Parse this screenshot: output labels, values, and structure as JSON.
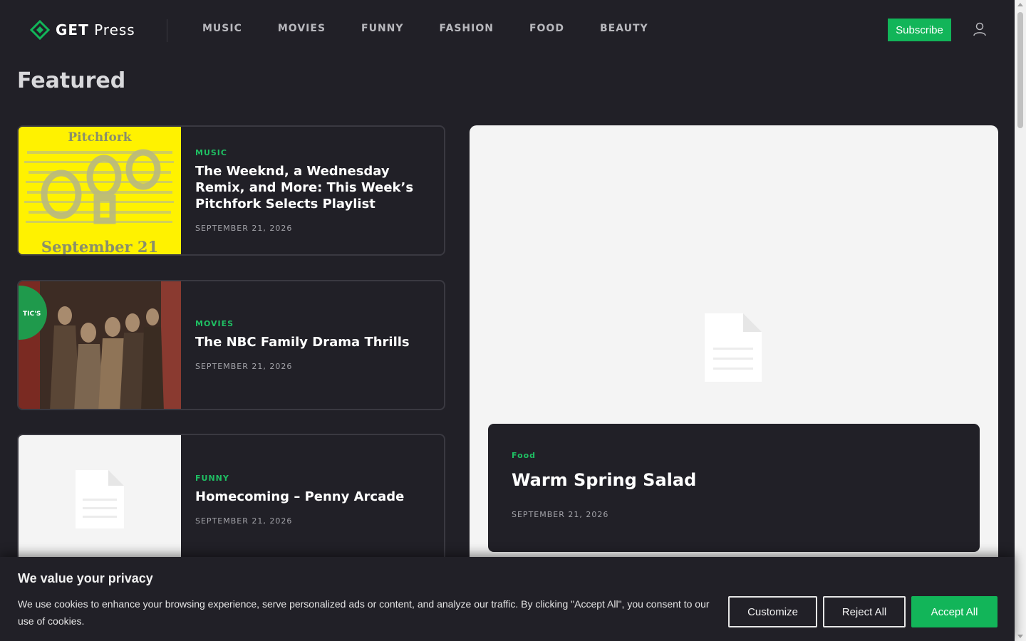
{
  "header": {
    "logo_bold": "GET",
    "logo_light": "Press",
    "nav": [
      "MUSIC",
      "MOVIES",
      "FUNNY",
      "FASHION",
      "FOOD",
      "BEAUTY"
    ],
    "subscribe_label": "Subscribe",
    "accent_color": "#12b559"
  },
  "page_title": "Featured",
  "cards": [
    {
      "category": "MUSIC",
      "title": "The Weeknd, a Wednesday Remix, and More: This Week’s Pitchfork Selects Playlist",
      "date": "SEPTEMBER 21, 2026",
      "thumb_top_text": "Pitchfork",
      "thumb_bottom_text": "September 21"
    },
    {
      "category": "MOVIES",
      "title": "The NBC Family Drama Thrills",
      "date": "SEPTEMBER 21, 2026",
      "badge_text": "TIC'S"
    },
    {
      "category": "FUNNY",
      "title": "Homecoming – Penny Arcade",
      "date": "SEPTEMBER 21, 2026"
    }
  ],
  "featured": {
    "category": "Food",
    "title": "Warm Spring Salad",
    "date": "SEPTEMBER 21, 2026"
  },
  "cookie": {
    "title": "We value your privacy",
    "text": "We use cookies to enhance your browsing experience, serve personalized ads or content, and analyze our traffic. By clicking \"Accept All\", you consent to our use of cookies.",
    "customize_label": "Customize",
    "reject_label": "Reject All",
    "accept_label": "Accept All"
  }
}
